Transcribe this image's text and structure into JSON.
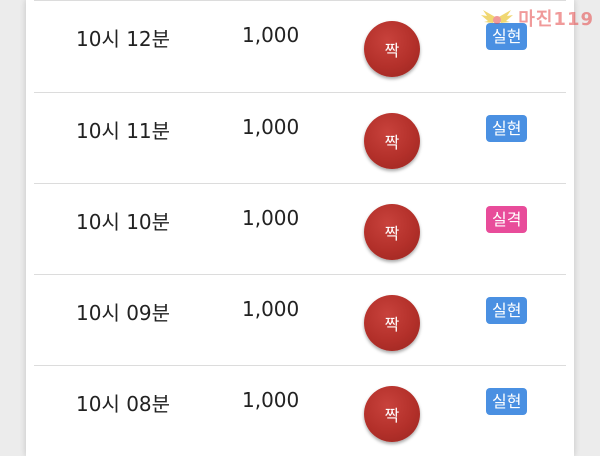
{
  "watermark": {
    "text": "마진119"
  },
  "colors": {
    "ball": "#b3302a",
    "badge_hit": "#4a90e2",
    "badge_miss": "#e84c9a"
  },
  "rows": [
    {
      "time": "10시 12분",
      "amount": "1,000",
      "result": "짝",
      "status": "실현",
      "status_type": "hit"
    },
    {
      "time": "10시 11분",
      "amount": "1,000",
      "result": "짝",
      "status": "실현",
      "status_type": "hit"
    },
    {
      "time": "10시 10분",
      "amount": "1,000",
      "result": "짝",
      "status": "실격",
      "status_type": "miss"
    },
    {
      "time": "10시 09분",
      "amount": "1,000",
      "result": "짝",
      "status": "실현",
      "status_type": "hit"
    },
    {
      "time": "10시 08분",
      "amount": "1,000",
      "result": "짝",
      "status": "실현",
      "status_type": "hit"
    }
  ]
}
